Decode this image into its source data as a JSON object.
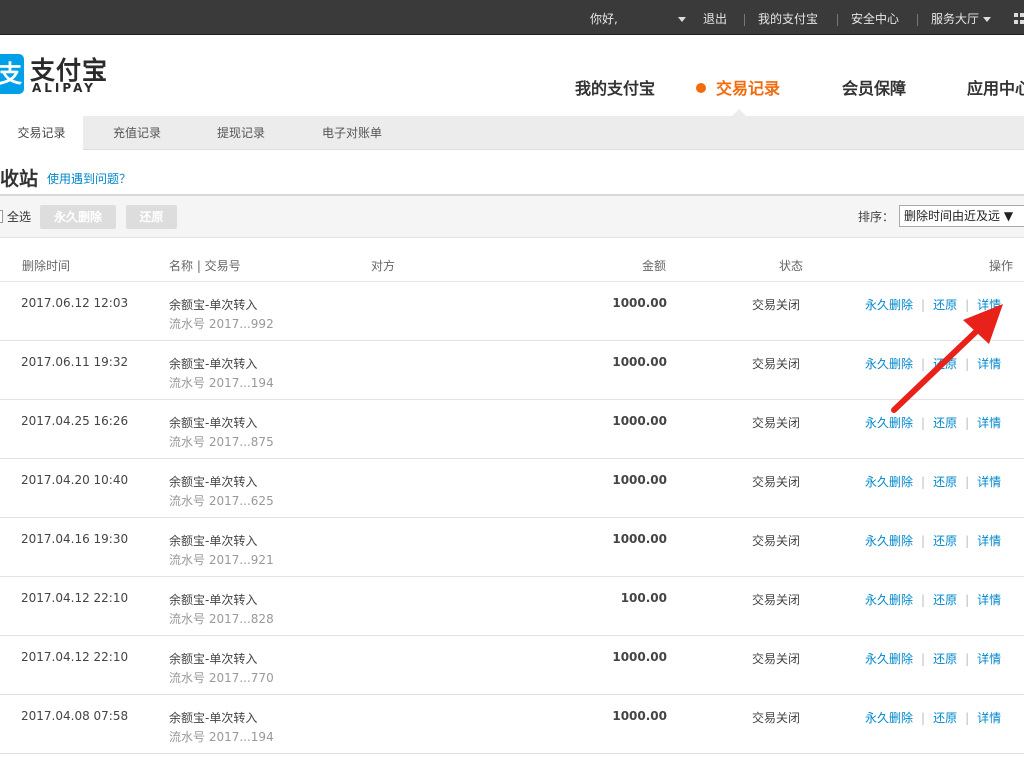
{
  "topbar": {
    "greeting": "你好,",
    "logout": "退出",
    "my_alipay": "我的支付宝",
    "security": "安全中心",
    "service": "服务大厅"
  },
  "brand": {
    "mark": "支",
    "name_cn": "支付宝",
    "name_en": "ALIPAY"
  },
  "mainnav": [
    "我的支付宝",
    "交易记录",
    "会员保障",
    "应用中心"
  ],
  "subnav": [
    "交易记录",
    "充值记录",
    "提现记录",
    "电子对账单"
  ],
  "page": {
    "title": "收站",
    "help": "使用遇到问题？"
  },
  "toolbar": {
    "select_all": "全选",
    "delete_btn": "永久删除",
    "restore_btn": "还原",
    "sort_label": "排序：",
    "sort_value": "删除时间由近及远 ▼"
  },
  "table": {
    "headers": {
      "time": "删除时间",
      "name": "名称 | 交易号",
      "party": "对方",
      "amount": "金额",
      "status": "状态",
      "ops": "操作"
    },
    "op_labels": {
      "delete": "永久删除",
      "restore": "还原",
      "detail": "详情"
    },
    "rows": [
      {
        "time": "2017.06.12 12:03",
        "name": "余额宝-单次转入",
        "serial": "流水号 2017...992",
        "amount": "1000.00",
        "status": "交易关闭"
      },
      {
        "time": "2017.06.11 19:32",
        "name": "余额宝-单次转入",
        "serial": "流水号 2017...194",
        "amount": "1000.00",
        "status": "交易关闭"
      },
      {
        "time": "2017.04.25 16:26",
        "name": "余额宝-单次转入",
        "serial": "流水号 2017...875",
        "amount": "1000.00",
        "status": "交易关闭"
      },
      {
        "time": "2017.04.20 10:40",
        "name": "余额宝-单次转入",
        "serial": "流水号 2017...625",
        "amount": "1000.00",
        "status": "交易关闭"
      },
      {
        "time": "2017.04.16 19:30",
        "name": "余额宝-单次转入",
        "serial": "流水号 2017...921",
        "amount": "1000.00",
        "status": "交易关闭"
      },
      {
        "time": "2017.04.12 22:10",
        "name": "余额宝-单次转入",
        "serial": "流水号 2017...828",
        "amount": "100.00",
        "status": "交易关闭"
      },
      {
        "time": "2017.04.12 22:10",
        "name": "余额宝-单次转入",
        "serial": "流水号 2017...770",
        "amount": "1000.00",
        "status": "交易关闭"
      },
      {
        "time": "2017.04.08 07:58",
        "name": "余额宝-单次转入",
        "serial": "流水号 2017...194",
        "amount": "1000.00",
        "status": "交易关闭"
      }
    ]
  },
  "colors": {
    "accent": "#f26c0f",
    "link": "#0088cc",
    "brand_blue": "#00a0e9",
    "annotation_arrow": "#e8221b"
  }
}
